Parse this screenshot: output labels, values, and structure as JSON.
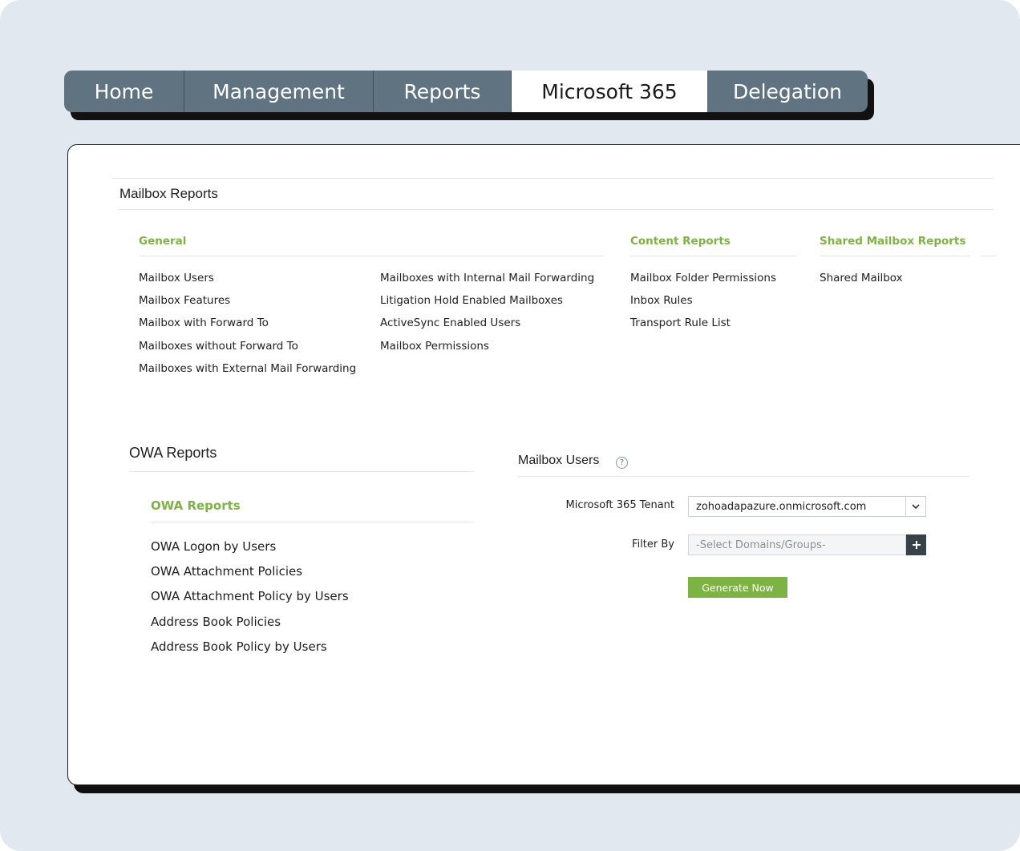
{
  "nav": {
    "tabs": [
      {
        "label": "Home"
      },
      {
        "label": "Management"
      },
      {
        "label": "Reports"
      },
      {
        "label": "Microsoft 365"
      },
      {
        "label": "Delegation"
      }
    ],
    "active_tab": "Microsoft 365"
  },
  "mailbox_reports": {
    "title": "Mailbox Reports",
    "general": {
      "heading": "General",
      "col1": [
        "Mailbox Users",
        "Mailbox Features",
        "Mailbox with Forward To",
        "Mailboxes without Forward To",
        "Mailboxes with External Mail Forwarding"
      ],
      "col2": [
        "Mailboxes with Internal Mail Forwarding",
        "Litigation Hold Enabled Mailboxes",
        "ActiveSync Enabled Users",
        "Mailbox Permissions"
      ]
    },
    "content": {
      "heading": "Content Reports",
      "items": [
        "Mailbox Folder Permissions",
        "Inbox Rules",
        "Transport Rule List"
      ]
    },
    "shared": {
      "heading": "Shared Mailbox Reports",
      "items": [
        "Shared Mailbox"
      ]
    }
  },
  "owa_reports": {
    "title": "OWA Reports",
    "heading": "OWA Reports",
    "items": [
      "OWA Logon by Users",
      "OWA Attachment Policies",
      "OWA Attachment Policy by Users",
      "Address Book Policies",
      "Address Book Policy by Users"
    ]
  },
  "report_form": {
    "title": "Mailbox Users",
    "help_glyph": "?",
    "tenant_label": "Microsoft 365 Tenant",
    "tenant_value": "zohoadapazure.onmicrosoft.com",
    "filter_label": "Filter By",
    "filter_placeholder": "-Select Domains/Groups-",
    "generate_label": "Generate Now"
  },
  "icons": {
    "dropdown": "chevron-down-icon",
    "add": "plus-icon",
    "help": "help-icon"
  },
  "colors": {
    "tab_bar": "#5f7381",
    "accent_green": "#7cb342",
    "page_background": "#e2e8f0"
  }
}
